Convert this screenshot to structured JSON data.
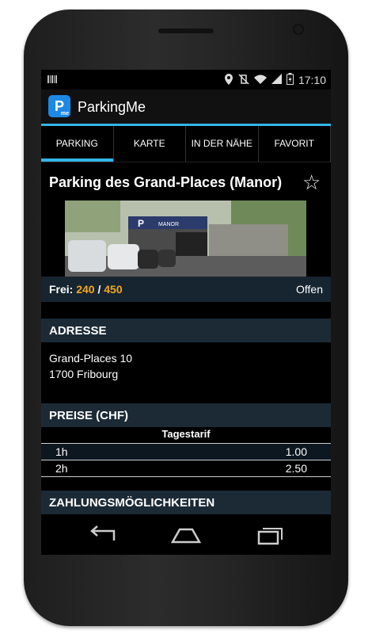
{
  "statusbar": {
    "time": "17:10"
  },
  "app": {
    "title": "ParkingMe",
    "icon_letter": "P",
    "icon_sub": "me"
  },
  "tabs": [
    {
      "label": "PARKING"
    },
    {
      "label": "KARTE"
    },
    {
      "label": "IN DER NÄHE"
    },
    {
      "label": "FAVORIT"
    }
  ],
  "parking": {
    "name": "Parking des Grand-Places (Manor)",
    "free_label": "Frei:",
    "free": "240",
    "separator": "/",
    "total": "450",
    "status": "Offen"
  },
  "sections": {
    "address": "ADRESSE",
    "prices": "PREISE (CHF)",
    "payment": "ZAHLUNGSMÖGLICHKEITEN"
  },
  "address": {
    "line1": "Grand-Places 10",
    "line2": "1700 Fribourg"
  },
  "prices": {
    "header": "Tagestarif",
    "rows": [
      {
        "duration": "1h",
        "price": "1.00"
      },
      {
        "duration": "2h",
        "price": "2.50"
      }
    ]
  },
  "photo": {
    "sign_p": "P",
    "sign_manor": "MANOR"
  },
  "colors": {
    "accent": "#33b5e5",
    "highlight": "#f3a71e",
    "section_bg": "#1c2a36"
  }
}
